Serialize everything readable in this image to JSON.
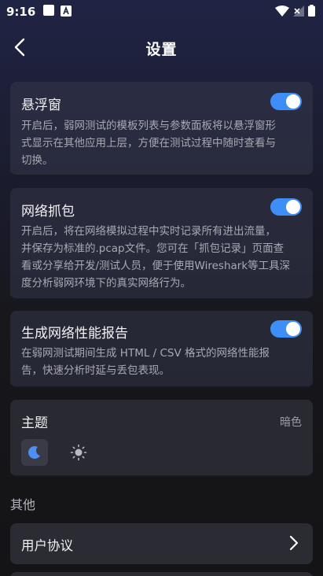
{
  "status_bar": {
    "time": "9:16",
    "icons": [
      "notification-icon",
      "a-app-icon",
      "wifi-icon",
      "no-signal-icon",
      "battery-icon"
    ]
  },
  "header": {
    "title": "设置",
    "back_icon": "chevron-left-icon"
  },
  "settings": {
    "floating_window": {
      "title": "悬浮窗",
      "desc": [
        "开启后，弱网测试的模板列表与参数面板将以悬浮窗形",
        "式显示在其他应用上层，方便在测试过程中随时查看与",
        "切换。"
      ],
      "enabled": true
    },
    "packet_capture": {
      "title": "网络抓包",
      "desc": [
        "开启后，将在网络模拟过程中实时记录所有进出流量，",
        "并保存为标准的.pcap文件。您可在「抓包记录」页面查",
        "看或分享给开发/测试人员，便于使用Wireshark等工具深",
        "度分析弱网环境下的真实网络行为。"
      ],
      "enabled": true
    },
    "perf_report": {
      "title": "生成网络性能报告",
      "desc": [
        "在弱网测试期间生成 HTML / CSV 格式的网络性能报",
        "告，快速分析时延与丢包表现。"
      ],
      "enabled": true
    },
    "theme": {
      "title": "主题",
      "value": "暗色",
      "options": [
        "moon-icon",
        "sun-icon"
      ],
      "selected": "moon-icon"
    }
  },
  "other": {
    "section_title": "其他",
    "items": [
      {
        "label": "用户协议",
        "icon": "chevron-right-icon"
      }
    ]
  },
  "colors": {
    "accent": "#3f8ef7",
    "card_bg": "#34364a",
    "text_secondary": "#a8a9b4"
  }
}
